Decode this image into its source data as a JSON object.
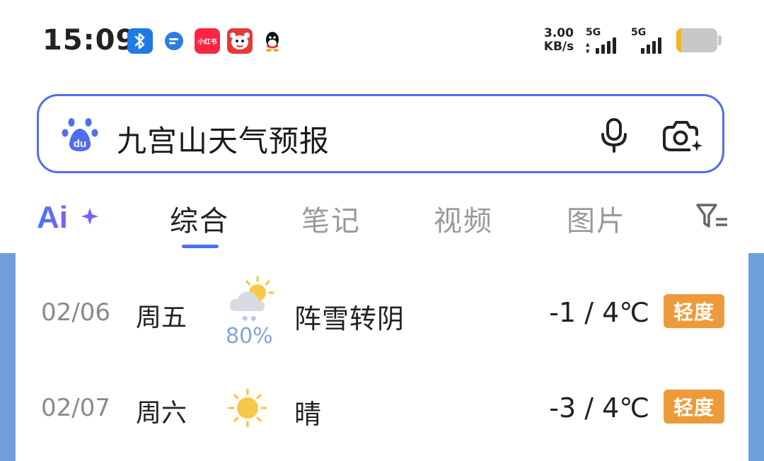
{
  "status_bar": {
    "time": "15:09",
    "net_speed_value": "3.00",
    "net_speed_unit": "KB/s",
    "sim1_label": "5G",
    "sim2_label": "5G",
    "battery_level": 0.12,
    "battery_color": "#f2b51c",
    "notification_icons": [
      "bluetooth-icon",
      "message-icon",
      "xiaohongshu-icon",
      "jd-icon",
      "qq-icon"
    ],
    "xhs_text": "小红书"
  },
  "search": {
    "query": "九宫山天气预报",
    "accent_color": "#4e6ef2"
  },
  "tabs": [
    {
      "label": "综合",
      "active": true
    },
    {
      "label": "笔记",
      "active": false
    },
    {
      "label": "视频",
      "active": false
    },
    {
      "label": "图片",
      "active": false
    }
  ],
  "forecast": [
    {
      "date": "02/06",
      "weekday": "周五",
      "icon": "snow-shower-to-cloudy-icon",
      "precip": "80%",
      "desc": "阵雪转阴",
      "temp": "-1 / 4℃",
      "aqi": "轻度"
    },
    {
      "date": "02/07",
      "weekday": "周六",
      "icon": "sunny-icon",
      "desc": "晴",
      "temp": "-3 / 4℃",
      "aqi": "轻度"
    }
  ],
  "colors": {
    "aqi_badge": "#ee9a3a",
    "side_panel": "#6f9fd8",
    "precip_text": "#7fa6d6"
  }
}
